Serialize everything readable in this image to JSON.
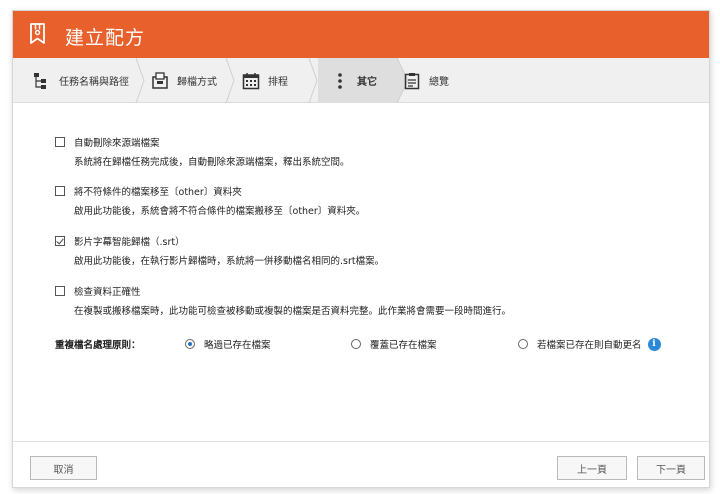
{
  "window": {
    "title": "建立配方"
  },
  "steps": [
    {
      "label": "任務名稱與路徑"
    },
    {
      "label": "歸檔方式"
    },
    {
      "label": "排程"
    },
    {
      "label": "其它"
    },
    {
      "label": "總覽"
    }
  ],
  "options": [
    {
      "label": "自動刪除來源端檔案",
      "desc": "系統將在歸檔任務完成後，自動刪除來源端檔案，釋出系統空間。",
      "checked": false
    },
    {
      "label": "將不符條件的檔案移至〔other〕資料夾",
      "desc": "啟用此功能後，系統會將不符合條件的檔案搬移至〔other〕資料夾。",
      "checked": false
    },
    {
      "label": "影片字幕智能歸檔（.srt）",
      "desc": "啟用此功能後，在執行影片歸檔時，系統將一併移動檔名相同的.srt檔案。",
      "checked": true
    },
    {
      "label": "檢查資料正確性",
      "desc": "在複製或搬移檔案時，此功能可檢查被移動或複製的檔案是否資料完整。此作業將會需要一段時間進行。",
      "checked": false
    }
  ],
  "duplicate_rule": {
    "label": "重複檔名處理原則：",
    "choices": [
      "略過已存在檔案",
      "覆蓋已存在檔案",
      "若檔案已存在則自動更名"
    ],
    "selected": "略過已存在檔案",
    "info_icon": "i"
  },
  "footer": {
    "cancel": "取消",
    "prev": "上一頁",
    "next": "下一頁"
  },
  "colors": {
    "titlebar": "#e8602b",
    "radio_selected": "#2b6fc6",
    "info_icon": "#2a8ad8"
  }
}
